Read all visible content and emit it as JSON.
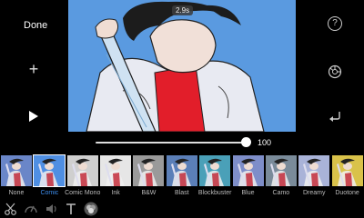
{
  "header": {
    "done_label": "Done"
  },
  "preview": {
    "duration_badge": "2.9s"
  },
  "slider": {
    "intensity_value": "100",
    "level": 1.0
  },
  "filters": [
    {
      "name": "None",
      "tint": "#6a86c8"
    },
    {
      "name": "Comic",
      "tint": "#4f8fe3"
    },
    {
      "name": "Comic Mono",
      "tint": "#cfcfcf"
    },
    {
      "name": "Ink",
      "tint": "#e6e6e6"
    },
    {
      "name": "B&W",
      "tint": "#9a9a9a"
    },
    {
      "name": "Blast",
      "tint": "#5b7fb8"
    },
    {
      "name": "Blockbuster",
      "tint": "#4aa0b8"
    },
    {
      "name": "Blue",
      "tint": "#7e8ec9"
    },
    {
      "name": "Camo",
      "tint": "#7a8b9a"
    },
    {
      "name": "Dreamy",
      "tint": "#a9b3d8"
    },
    {
      "name": "Duotone",
      "tint": "#d9c24a"
    }
  ],
  "selected_filter": "Comic",
  "toolbar": {
    "icons": [
      "scissors-icon",
      "speed-icon",
      "volume-icon",
      "text-icon",
      "filters-icon"
    ]
  },
  "colors": {
    "accent": "#3d8ef0",
    "background": "#000000"
  }
}
